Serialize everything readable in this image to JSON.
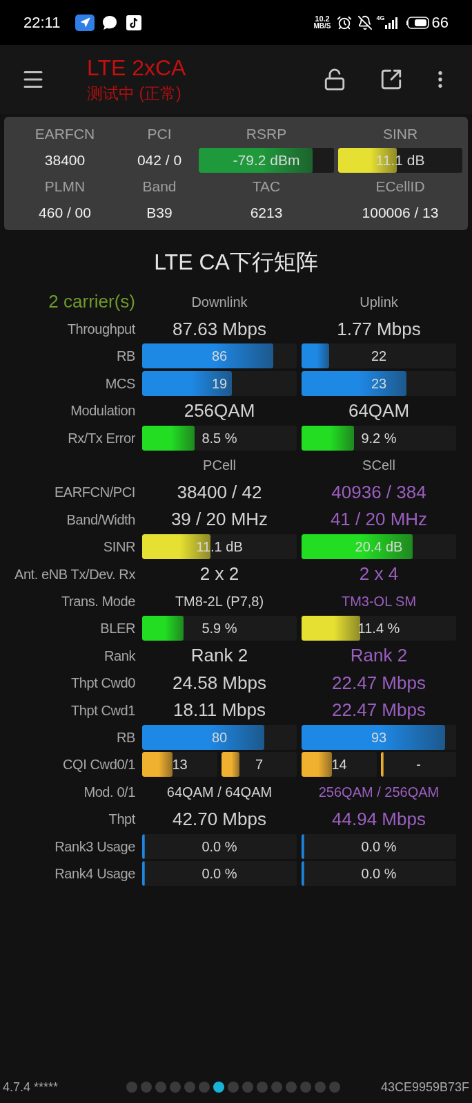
{
  "status_bar": {
    "time": "22:11",
    "speed_value": "10.2",
    "speed_unit": "MB/S",
    "network": "4G",
    "battery": "66"
  },
  "toolbar": {
    "title": "LTE 2xCA",
    "subtitle": "测试中 (正常)"
  },
  "serving_cell": {
    "rows": [
      {
        "kind": "labels",
        "cells": [
          {
            "text": "EARFCN"
          },
          {
            "text": "PCI"
          },
          {
            "text": "RSRP"
          },
          {
            "text": "SINR"
          }
        ]
      },
      {
        "kind": "values",
        "cells": [
          {
            "text": "38400"
          },
          {
            "text": "042 / 0"
          },
          {
            "text": "-79.2 dBm",
            "level": 0.84,
            "color": "#1e9a3c"
          },
          {
            "text": "11.1 dB",
            "level": 0.47,
            "color": "#e6e032"
          }
        ]
      },
      {
        "kind": "labels",
        "cells": [
          {
            "text": "PLMN"
          },
          {
            "text": "Band"
          },
          {
            "text": "TAC"
          },
          {
            "text": "ECellID"
          }
        ]
      },
      {
        "kind": "values",
        "cells": [
          {
            "text": "460 / 00"
          },
          {
            "text": "B39"
          },
          {
            "text": "6213"
          },
          {
            "text": "100006 / 13"
          }
        ]
      }
    ]
  },
  "matrix": {
    "title": "LTE CA下行矩阵",
    "rows": [
      {
        "kind": "header",
        "label": "2 carrier(s)",
        "cells": [
          {
            "text": "Downlink"
          },
          {
            "text": "Uplink"
          }
        ]
      },
      {
        "kind": "value",
        "label": "Throughput",
        "cells": [
          {
            "text": "87.63 Mbps"
          },
          {
            "text": "1.77 Mbps"
          }
        ]
      },
      {
        "kind": "bar",
        "label": "RB",
        "cells": [
          {
            "text": "86",
            "level": 0.85,
            "color": "#1e88e5"
          },
          {
            "text": "22",
            "level": 0.18,
            "color": "#1e88e5"
          }
        ]
      },
      {
        "kind": "bar",
        "label": "MCS",
        "cells": [
          {
            "text": "19",
            "level": 0.58,
            "color": "#1e88e5"
          },
          {
            "text": "23",
            "level": 0.68,
            "color": "#1e88e5"
          }
        ]
      },
      {
        "kind": "value",
        "label": "Modulation",
        "cells": [
          {
            "text": "256QAM"
          },
          {
            "text": "64QAM"
          }
        ]
      },
      {
        "kind": "bar",
        "label": "Rx/Tx Error",
        "cells": [
          {
            "text": "8.5 %",
            "level": 0.34,
            "color": "#22dd22"
          },
          {
            "text": "9.2 %",
            "level": 0.34,
            "color": "#22dd22"
          }
        ]
      },
      {
        "kind": "header",
        "label": "",
        "cells": [
          {
            "text": "PCell"
          },
          {
            "text": "SCell"
          }
        ]
      },
      {
        "kind": "value",
        "label": "EARFCN/PCI",
        "cells": [
          {
            "text": "38400 / 42"
          },
          {
            "text": "40936 / 384",
            "color": "#9b5fc0"
          }
        ]
      },
      {
        "kind": "value",
        "label": "Band/Width",
        "cells": [
          {
            "text": "39 / 20 MHz"
          },
          {
            "text": "41 / 20 MHz",
            "color": "#9b5fc0"
          }
        ]
      },
      {
        "kind": "bar",
        "label": "SINR",
        "cells": [
          {
            "text": "11.1 dB",
            "level": 0.44,
            "color": "#e6e032"
          },
          {
            "text": "20.4 dB",
            "level": 0.72,
            "color": "#22dd22"
          }
        ]
      },
      {
        "kind": "value",
        "label": "Ant. eNB Tx/Dev. Rx",
        "cells": [
          {
            "text": "2 x 2"
          },
          {
            "text": "2 x 4",
            "color": "#9b5fc0"
          }
        ]
      },
      {
        "kind": "note",
        "label": "Trans. Mode",
        "cells": [
          {
            "text": "TM8-2L (P7,8)"
          },
          {
            "text": "TM3-OL SM",
            "color": "#9b5fc0"
          }
        ]
      },
      {
        "kind": "bar",
        "label": "BLER",
        "cells": [
          {
            "text": "5.9 %",
            "level": 0.27,
            "color": "#22dd22"
          },
          {
            "text": "11.4 %",
            "level": 0.38,
            "color": "#e6e032"
          }
        ]
      },
      {
        "kind": "value",
        "label": "Rank",
        "cells": [
          {
            "text": "Rank 2"
          },
          {
            "text": "Rank 2",
            "color": "#9b5fc0"
          }
        ]
      },
      {
        "kind": "value",
        "label": "Thpt Cwd0",
        "cells": [
          {
            "text": "24.58 Mbps"
          },
          {
            "text": "22.47 Mbps",
            "color": "#9b5fc0"
          }
        ]
      },
      {
        "kind": "value",
        "label": "Thpt Cwd1",
        "cells": [
          {
            "text": "18.11 Mbps"
          },
          {
            "text": "22.47 Mbps",
            "color": "#9b5fc0"
          }
        ]
      },
      {
        "kind": "bar",
        "label": "RB",
        "cells": [
          {
            "text": "80",
            "level": 0.79,
            "color": "#1e88e5"
          },
          {
            "text": "93",
            "level": 0.93,
            "color": "#1e88e5"
          }
        ]
      },
      {
        "kind": "dual_bar",
        "label": "CQI Cwd0/1",
        "cells": [
          {
            "parts": [
              {
                "text": "13",
                "level": 0.4,
                "color": "#f0b030"
              },
              {
                "text": "7",
                "level": 0.24,
                "color": "#f0b030"
              }
            ]
          },
          {
            "parts": [
              {
                "text": "14",
                "level": 0.4,
                "color": "#f0b030"
              },
              {
                "text": "-",
                "level": 0,
                "color": "#f0b030"
              }
            ]
          }
        ]
      },
      {
        "kind": "note",
        "label": "Mod. 0/1",
        "cells": [
          {
            "text": "64QAM / 64QAM"
          },
          {
            "text": "256QAM / 256QAM",
            "color": "#9b5fc0"
          }
        ]
      },
      {
        "kind": "value",
        "label": "Thpt",
        "cells": [
          {
            "text": "42.70 Mbps"
          },
          {
            "text": "44.94 Mbps",
            "color": "#9b5fc0"
          }
        ]
      },
      {
        "kind": "bar",
        "label": "Rank3 Usage",
        "cells": [
          {
            "text": "0.0 %",
            "level": 0,
            "color": "#1e88e5"
          },
          {
            "text": "0.0 %",
            "level": 0,
            "color": "#1e88e5"
          }
        ]
      },
      {
        "kind": "bar",
        "label": "Rank4 Usage",
        "cells": [
          {
            "text": "0.0 %",
            "level": 0,
            "color": "#1e88e5"
          },
          {
            "text": "0.0 %",
            "level": 0,
            "color": "#1e88e5"
          }
        ]
      }
    ]
  },
  "footer": {
    "version": "4.7.4 *****",
    "pages": [
      {
        "selected": false
      },
      {
        "selected": false
      },
      {
        "selected": false
      },
      {
        "selected": false
      },
      {
        "selected": false
      },
      {
        "selected": false
      },
      {
        "selected": true
      },
      {
        "selected": false
      },
      {
        "selected": false
      },
      {
        "selected": false
      },
      {
        "selected": false
      },
      {
        "selected": false
      },
      {
        "selected": false
      },
      {
        "selected": false
      },
      {
        "selected": false
      }
    ],
    "device_id": "43CE9959B73F"
  }
}
